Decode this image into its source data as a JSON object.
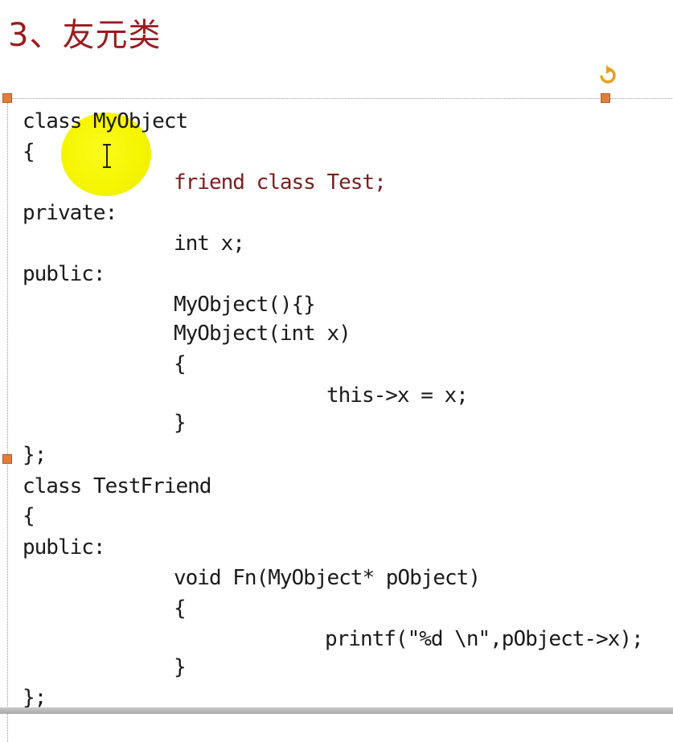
{
  "slide": {
    "title": "3、友元类"
  },
  "code": {
    "lines": [
      "class MyObject",
      "{",
      "friend class Test;",
      "private:",
      "int x;",
      "public:",
      "MyObject(){}",
      "MyObject(int x)",
      "{",
      "this->x = x;",
      "}",
      "};",
      "class TestFriend",
      "{",
      "public:",
      "void Fn(MyObject* pObject)",
      "{",
      "printf(\"%d \\n\",pObject->x);",
      "}",
      "};"
    ]
  },
  "colors": {
    "title": "#9b1b1e",
    "friend_line": "#7a1d1d",
    "code_text": "#1a1a1a",
    "handle": "#e07e3c",
    "highlight": "#f5f500"
  },
  "icons": {
    "rotate": "rotate-handle-icon",
    "cursor": "text-cursor-ibeam-icon"
  }
}
